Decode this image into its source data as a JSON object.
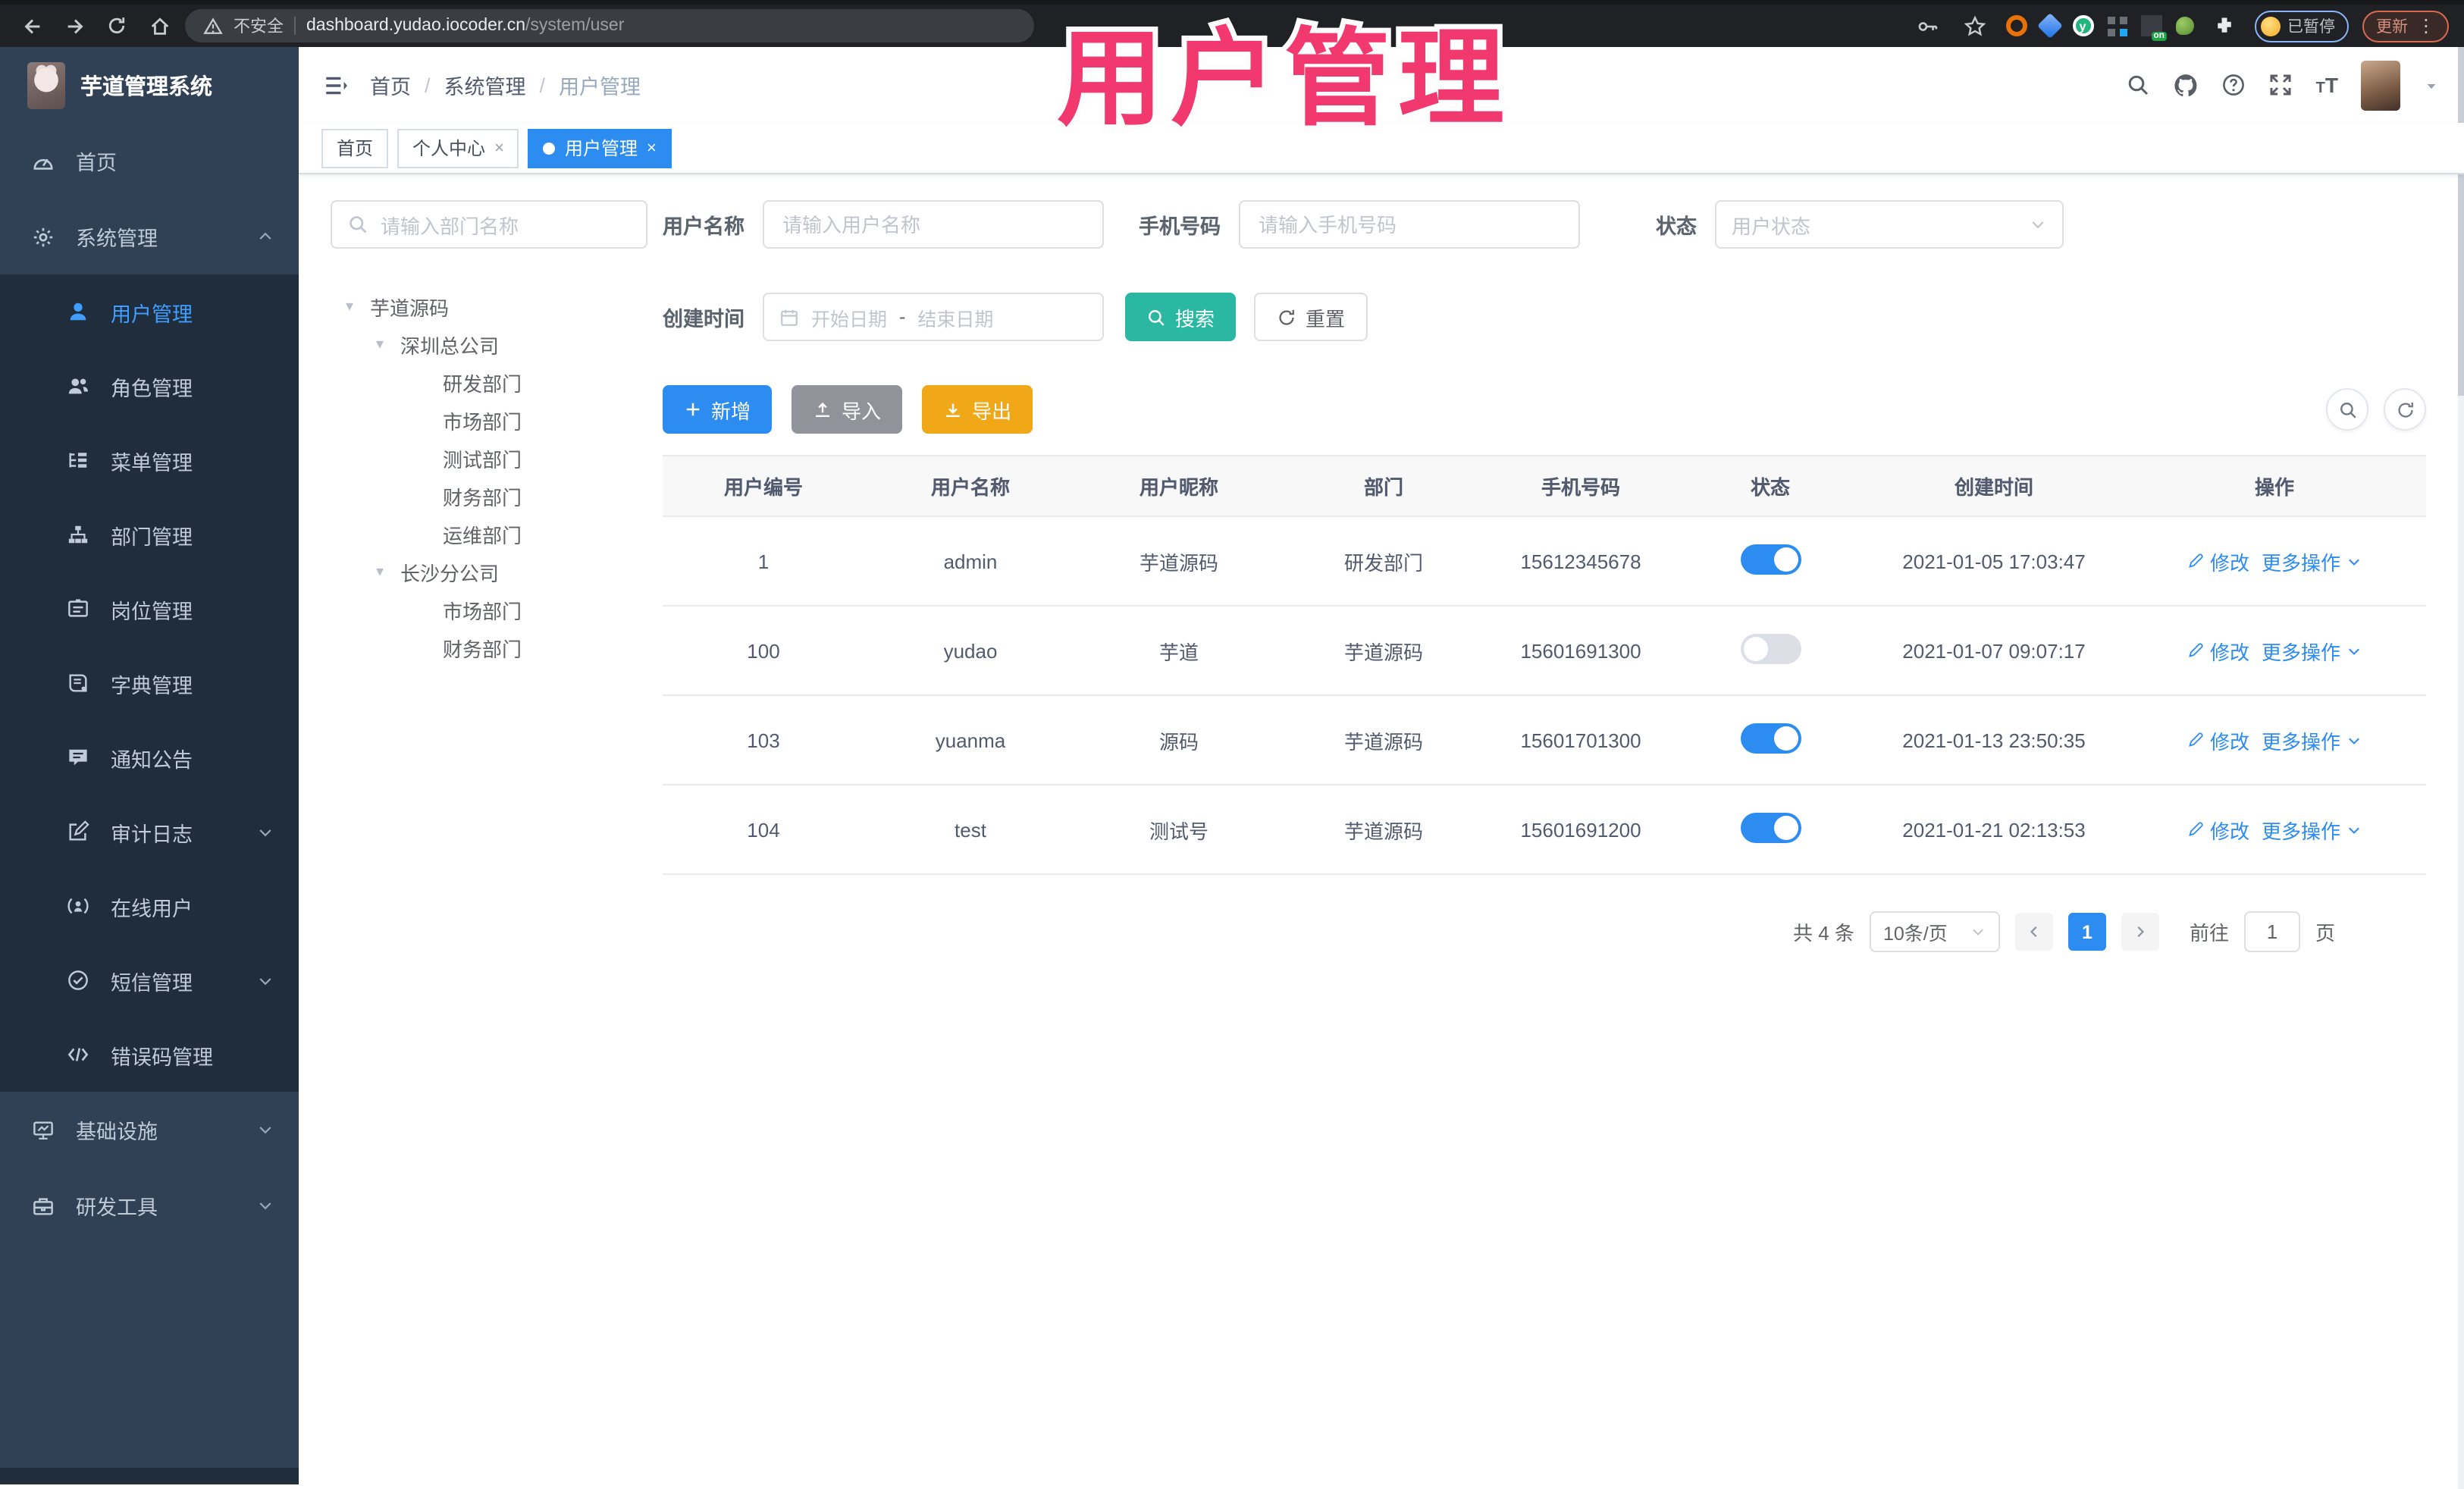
{
  "browser": {
    "security_label": "不安全",
    "url_host": "dashboard.yudao.iocoder.cn",
    "url_path": "/system/user",
    "ext_on_badge": "on",
    "paused_badge": "已暂停",
    "update_button": "更新"
  },
  "overlay_title": "用户管理",
  "sidebar": {
    "app_title": "芋道管理系统",
    "menu": [
      "首页",
      "系统管理",
      "用户管理",
      "角色管理",
      "菜单管理",
      "部门管理",
      "岗位管理",
      "字典管理",
      "通知公告",
      "审计日志",
      "在线用户",
      "短信管理",
      "错误码管理",
      "基础设施",
      "研发工具"
    ]
  },
  "navbar": {
    "breadcrumb": [
      "首页",
      "系统管理",
      "用户管理"
    ]
  },
  "tabs": {
    "home": "首页",
    "profile": "个人中心",
    "user": "用户管理"
  },
  "dept_tree": {
    "search_placeholder": "请输入部门名称",
    "nodes": [
      {
        "label": "芋道源码",
        "pad": "10px",
        "caret": "▾"
      },
      {
        "label": "深圳总公司",
        "pad": "30px",
        "caret": "▾"
      },
      {
        "label": "研发部门",
        "pad": "58px",
        "caret": ""
      },
      {
        "label": "市场部门",
        "pad": "58px",
        "caret": ""
      },
      {
        "label": "测试部门",
        "pad": "58px",
        "caret": ""
      },
      {
        "label": "财务部门",
        "pad": "58px",
        "caret": ""
      },
      {
        "label": "运维部门",
        "pad": "58px",
        "caret": ""
      },
      {
        "label": "长沙分公司",
        "pad": "30px",
        "caret": "▾"
      },
      {
        "label": "市场部门",
        "pad": "58px",
        "caret": ""
      },
      {
        "label": "财务部门",
        "pad": "58px",
        "caret": ""
      }
    ]
  },
  "filters": {
    "username_label": "用户名称",
    "username_placeholder": "请输入用户名称",
    "mobile_label": "手机号码",
    "mobile_placeholder": "请输入手机号码",
    "status_label": "状态",
    "status_placeholder": "用户状态",
    "create_time_label": "创建时间",
    "date_start": "开始日期",
    "date_sep": "-",
    "date_end": "结束日期",
    "search_button": "搜索",
    "reset_button": "重置"
  },
  "toolbar": {
    "add": "新增",
    "import": "导入",
    "export": "导出"
  },
  "table": {
    "columns": [
      "用户编号",
      "用户名称",
      "用户昵称",
      "部门",
      "手机号码",
      "状态",
      "创建时间",
      "操作"
    ],
    "edit_label": "修改",
    "more_label": "更多操作",
    "rows": [
      {
        "id": "1",
        "username": "admin",
        "nickname": "芋道源码",
        "dept": "研发部门",
        "mobile": "15612345678",
        "status_on": true,
        "create_time": "2021-01-05 17:03:47"
      },
      {
        "id": "100",
        "username": "yudao",
        "nickname": "芋道",
        "dept": "芋道源码",
        "mobile": "15601691300",
        "status_on": false,
        "create_time": "2021-01-07 09:07:17"
      },
      {
        "id": "103",
        "username": "yuanma",
        "nickname": "源码",
        "dept": "芋道源码",
        "mobile": "15601701300",
        "status_on": true,
        "create_time": "2021-01-13 23:50:35"
      },
      {
        "id": "104",
        "username": "test",
        "nickname": "测试号",
        "dept": "芋道源码",
        "mobile": "15601691200",
        "status_on": true,
        "create_time": "2021-01-21 02:13:53"
      }
    ]
  },
  "pagination": {
    "total_text": "共 4 条",
    "page_size": "10条/页",
    "current_page": "1",
    "goto_label": "前往",
    "goto_value": "1",
    "page_unit": "页"
  },
  "colors": {
    "accent_blue": "#2d8cf0",
    "sidebar_bg": "#304156",
    "submenu_bg": "#1f2d3d",
    "active_link": "#409eff",
    "search_teal": "#2bb8a3",
    "export_amber": "#f0a818",
    "title_pink": "#f2396f"
  }
}
